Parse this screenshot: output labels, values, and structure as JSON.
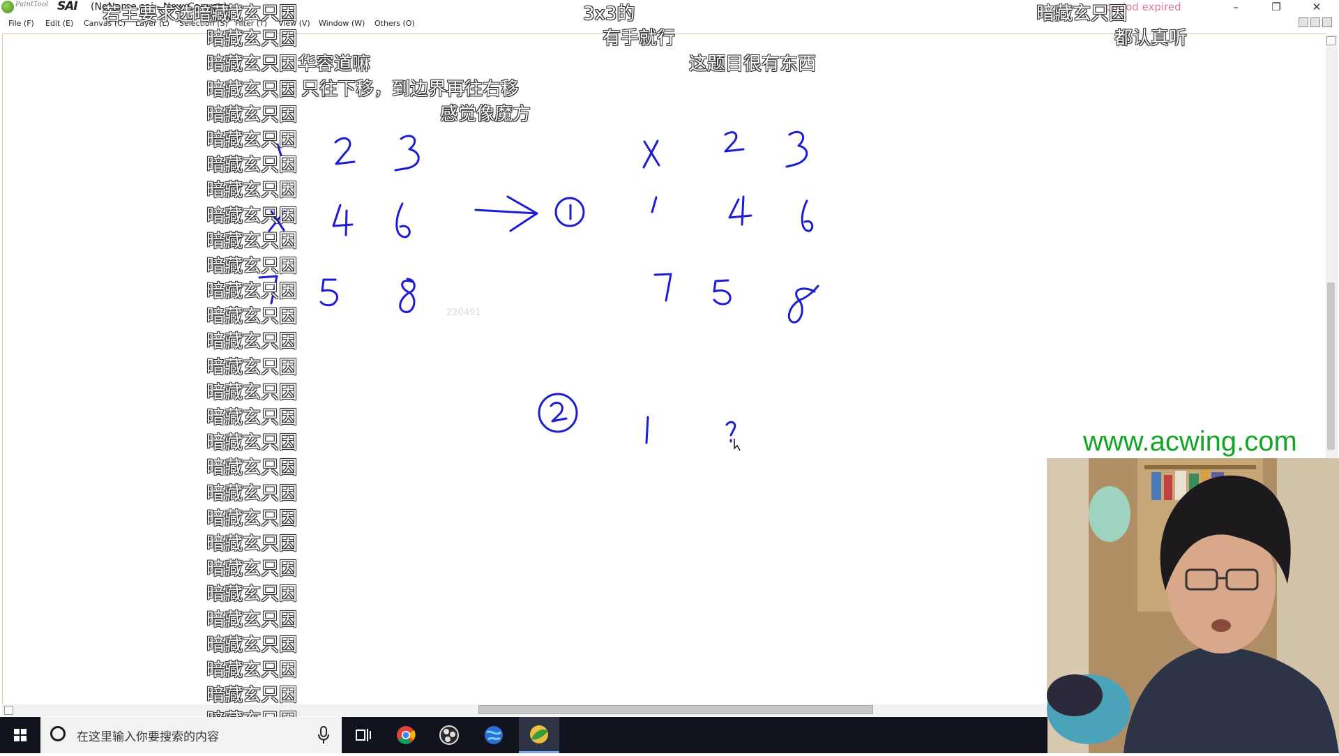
{
  "window": {
    "app_brand_small": "PaintTool",
    "app_brand": "SAI",
    "doc_title": "(NoName.sai - New Canvas)",
    "trial_notice": "period expired",
    "controls": {
      "minimize": "–",
      "maximize": "❐",
      "close": "✕"
    }
  },
  "menu": {
    "items": [
      "File (F)",
      "Edit (E)",
      "Canvas (C)",
      "Layer (L)",
      "Selection (S)",
      "Filter (T)",
      "View (V)",
      "Window (W)",
      "Others (O)"
    ]
  },
  "canvas": {
    "watermark_number": "220491"
  },
  "danmaku": {
    "repeated": "暗藏玄只因",
    "repeat_count": 29,
    "line_top_left": "若主要求选暗藏",
    "line_3x3": "3x3的",
    "line_easy": "有手就行",
    "line_huarong": "华容道嘛",
    "line_move": "只往下移，到边界再往右移",
    "line_rubik": "感觉像魔方",
    "line_interesting": "这题目很有东西",
    "line_top_right": "暗藏玄只因",
    "line_listen": "都认真听"
  },
  "handwriting": {
    "grid_left": [
      "1",
      "2",
      "3",
      "x",
      "4",
      "6",
      "7",
      "5",
      "8"
    ],
    "step1_label": "1",
    "grid_right": [
      "x",
      "2",
      "3",
      "1",
      "4",
      "6",
      "7",
      "5",
      "8"
    ],
    "step2_label": "2",
    "step2_values": [
      "1",
      "?"
    ],
    "ink_color": "#1c1cd4"
  },
  "site": {
    "url": "www.acwing.com",
    "color": "#13a523"
  },
  "taskbar": {
    "search_placeholder": "在这里输入你要搜索的内容",
    "apps": [
      "start-icon",
      "task-view-icon",
      "chrome-icon",
      "obs-icon",
      "globe-icon",
      "sai-icon"
    ]
  }
}
